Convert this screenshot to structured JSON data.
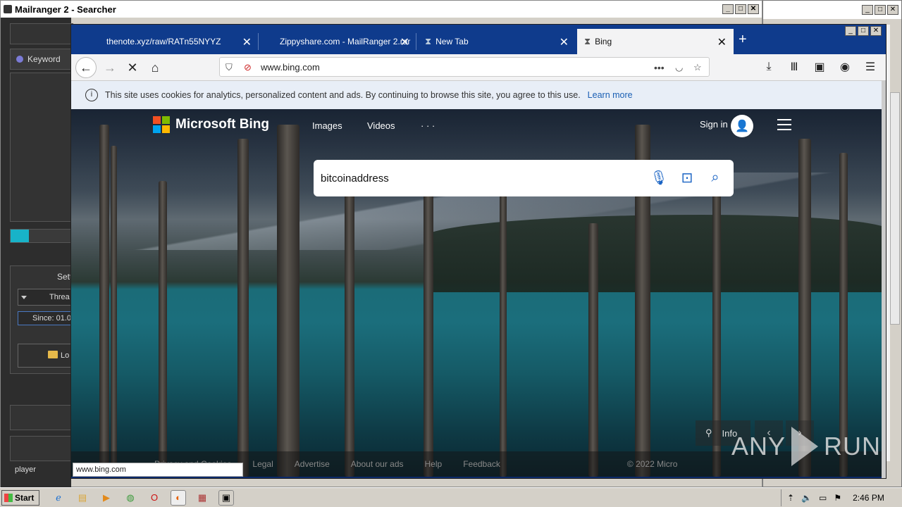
{
  "mailranger": {
    "title": "Mailranger 2 - Searcher",
    "keyword_label": "Keyword",
    "settings_label": "Setti",
    "threads_label": "Threa",
    "since_label": "Since: 01.0",
    "load_label": "Lo",
    "status_text": "player",
    "progress": 0.29
  },
  "firefox": {
    "tabs": [
      {
        "label": "thenote.xyz/raw/RATn55NYYZ"
      },
      {
        "label": "Zippyshare.com - MailRanger 2.rar"
      },
      {
        "label": "New Tab"
      },
      {
        "label": "Bing"
      }
    ],
    "url": "www.bing.com",
    "cookie_text": "This site uses cookies for analytics, personalized content and ads. By continuing to browse this site, you agree to this use.",
    "cookie_link": "Learn more",
    "hover_url": "www.bing.com"
  },
  "bing": {
    "logo_text": "Microsoft Bing",
    "nav": [
      "Images",
      "Videos",
      "· · ·"
    ],
    "signin": "Sign in",
    "search_query": "bitcoinaddress",
    "info_label": "Info",
    "footer_links": [
      "Privacy and Cookies",
      "Legal",
      "Advertise",
      "About our ads",
      "Help",
      "Feedback"
    ],
    "footer_copyright": "© 2022 Micro"
  },
  "watermark": {
    "left": "ANY",
    "right": "RUN"
  },
  "taskbar": {
    "start_label": "Start",
    "clock": "2:46 PM"
  },
  "colors": {
    "tab_bar": "#0f3b8c",
    "accent_link": "#1a5fb4",
    "search_icon": "#1a64c4",
    "progress_fill": "#18b3c8"
  }
}
